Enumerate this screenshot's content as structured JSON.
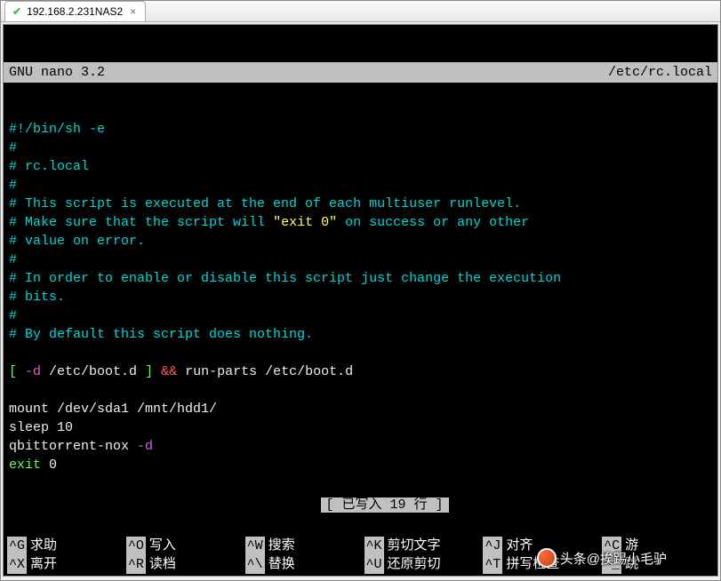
{
  "tab": {
    "title": "192.168.2.231NAS2"
  },
  "titlebar": {
    "app": "GNU nano 3.2",
    "filename": "/etc/rc.local"
  },
  "lines": [
    [
      {
        "c": "cyan",
        "t": "#!/bin/sh -e"
      }
    ],
    [
      {
        "c": "cyan",
        "t": "#"
      }
    ],
    [
      {
        "c": "cyan",
        "t": "# rc.local"
      }
    ],
    [
      {
        "c": "cyan",
        "t": "#"
      }
    ],
    [
      {
        "c": "cyan",
        "t": "# This script is executed at the end of each multiuser runlevel."
      }
    ],
    [
      {
        "c": "cyan",
        "t": "# Make sure that the script will "
      },
      {
        "c": "yellow",
        "t": "\"exit 0\""
      },
      {
        "c": "cyan",
        "t": " on success or any other"
      }
    ],
    [
      {
        "c": "cyan",
        "t": "# value on error."
      }
    ],
    [
      {
        "c": "cyan",
        "t": "#"
      }
    ],
    [
      {
        "c": "cyan",
        "t": "# In order to enable or disable this script just change the execution"
      }
    ],
    [
      {
        "c": "cyan",
        "t": "# bits."
      }
    ],
    [
      {
        "c": "cyan",
        "t": "#"
      }
    ],
    [
      {
        "c": "cyan",
        "t": "# By default this script does nothing."
      }
    ],
    [],
    [
      {
        "c": "green",
        "t": "["
      },
      {
        "c": "magenta",
        "t": " -d "
      },
      {
        "c": "white",
        "t": "/etc/boot.d "
      },
      {
        "c": "green",
        "t": "]"
      },
      {
        "c": "red",
        "t": " && "
      },
      {
        "c": "white",
        "t": "run-parts /etc/boot.d"
      }
    ],
    [],
    [
      {
        "c": "white",
        "t": "mount /dev/sda1 /mnt/hdd1/"
      }
    ],
    [
      {
        "c": "white",
        "t": "sleep 10"
      }
    ],
    [
      {
        "c": "white",
        "t": "qbittorrent-nox"
      },
      {
        "c": "magenta",
        "t": " -d"
      }
    ],
    [
      {
        "c": "green",
        "t": "exit"
      },
      {
        "c": "white",
        "t": " 0"
      }
    ]
  ],
  "status": "[ 已写入 19 行 ]",
  "shortcuts": [
    {
      "key": "^G",
      "label": "求助"
    },
    {
      "key": "^O",
      "label": "写入"
    },
    {
      "key": "^W",
      "label": "搜索"
    },
    {
      "key": "^K",
      "label": "剪切文字"
    },
    {
      "key": "^J",
      "label": "对齐"
    },
    {
      "key": "^C",
      "label": "游"
    },
    {
      "key": "^X",
      "label": "离开"
    },
    {
      "key": "^R",
      "label": "读档"
    },
    {
      "key": "^\\",
      "label": "替换"
    },
    {
      "key": "^U",
      "label": "还原剪切"
    },
    {
      "key": "^T",
      "label": "拼写检查"
    },
    {
      "key": "^_",
      "label": "跳"
    }
  ],
  "watermark": "头条@挨踢小毛驴"
}
